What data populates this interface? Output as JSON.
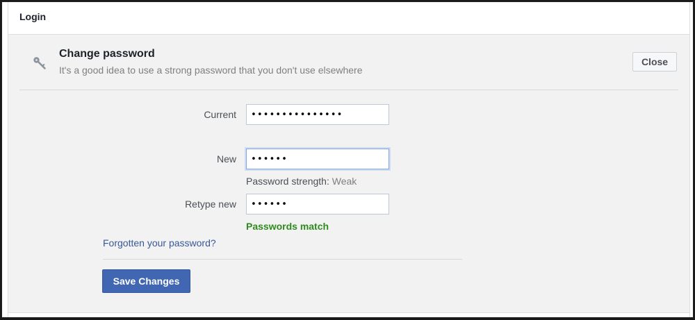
{
  "header": {
    "title": "Login"
  },
  "section": {
    "icon": "key-icon",
    "title": "Change password",
    "subtitle": "It's a good idea to use a strong password that you don't use elsewhere",
    "close_label": "Close"
  },
  "form": {
    "current": {
      "label": "Current",
      "value": "•••••••••••••••"
    },
    "new": {
      "label": "New",
      "value": "••••••"
    },
    "strength_label": "Password strength:",
    "strength_value": "Weak",
    "retype": {
      "label": "Retype new",
      "value": "••••••"
    },
    "match_message": "Passwords match",
    "forgot_link": "Forgotten your password?",
    "save_label": "Save Changes"
  },
  "colors": {
    "primary_button": "#4267b2",
    "link": "#365899",
    "success": "#2e8b1e",
    "panel_background": "#f2f2f2"
  }
}
